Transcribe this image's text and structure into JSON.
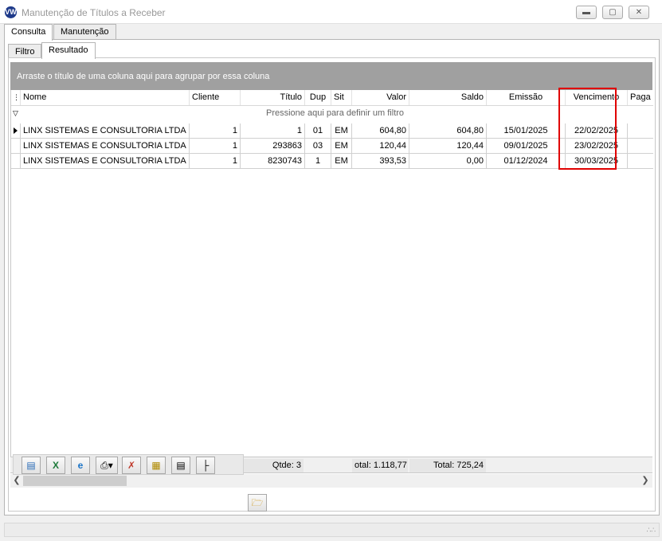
{
  "window": {
    "title": "Manutenção de Títulos a Receber",
    "icon_name": "vw-logo-icon"
  },
  "top_tabs": [
    {
      "label": "Consulta",
      "active": true
    },
    {
      "label": "Manutenção",
      "active": false
    }
  ],
  "inner_tabs": [
    {
      "label": "Filtro",
      "active": false
    },
    {
      "label": "Resultado",
      "active": true
    }
  ],
  "group_bar": {
    "text": "Arraste o título de uma coluna aqui para agrupar por essa coluna"
  },
  "grid": {
    "columns": [
      "Nome",
      "Cliente",
      "Título",
      "Dup",
      "Sit",
      "Valor",
      "Saldo",
      "Emissão",
      "Vencimento",
      "Paga"
    ],
    "filter_hint": "Pressione aqui para definir um filtro",
    "rows": [
      [
        "LINX SISTEMAS E CONSULTORIA LTDA",
        "1",
        "1",
        "01",
        "EM",
        "604,80",
        "604,80",
        "15/01/2025",
        "22/02/2025",
        ""
      ],
      [
        "LINX SISTEMAS E CONSULTORIA LTDA",
        "1",
        "293863",
        "03",
        "EM",
        "120,44",
        "120,44",
        "09/01/2025",
        "23/02/2025",
        ""
      ],
      [
        "LINX SISTEMAS E CONSULTORIA LTDA",
        "1",
        "8230743",
        "1",
        "EM",
        "393,53",
        "0,00",
        "01/12/2024",
        "30/03/2025",
        ""
      ]
    ],
    "highlighted_column": "Vencimento",
    "highlight_color": "#e00000"
  },
  "footer": {
    "qtde": "Qtde: 3",
    "total_valor": "otal: 1.118,77",
    "total_saldo": "Total: 725,24"
  },
  "toolbar": {
    "buttons": [
      "export-icon",
      "excel-icon",
      "internet-explorer-icon",
      "print-icon",
      "delete-document-icon",
      "document-icon",
      "collapse-icon",
      "expand-tree-icon",
      "open-folder-icon"
    ]
  }
}
